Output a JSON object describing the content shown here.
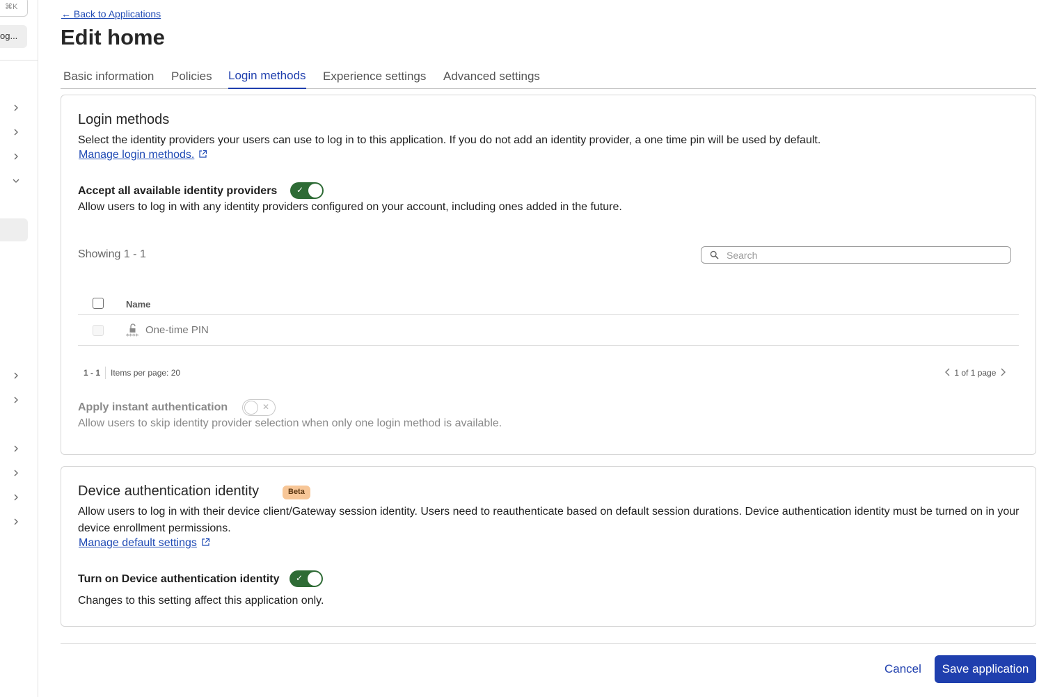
{
  "sidebar": {
    "shortcut_hint": "⌘K",
    "account_label": "og...",
    "icons": [
      "chevron-right-icon",
      "chevron-down-icon"
    ]
  },
  "header": {
    "back_link": "← Back to Applications",
    "title": "Edit home"
  },
  "tabs": [
    {
      "label": "Basic information",
      "active": false
    },
    {
      "label": "Policies",
      "active": false
    },
    {
      "label": "Login methods",
      "active": true
    },
    {
      "label": "Experience settings",
      "active": false
    },
    {
      "label": "Advanced settings",
      "active": false
    }
  ],
  "login_methods": {
    "title": "Login methods",
    "description": "Select the identity providers your users can use to log in to this application. If you do not add an identity provider, a one time pin will be used by default.",
    "manage_link": "Manage login methods.",
    "accept_all": {
      "label": "Accept all available identity providers",
      "enabled": true,
      "description": "Allow users to log in with any identity providers configured on your account, including ones added in the future."
    },
    "showing": "Showing 1 - 1",
    "search_placeholder": "Search",
    "table": {
      "columns": [
        "Name"
      ],
      "rows": [
        {
          "name": "One-time PIN",
          "icon": "lock-pin-icon",
          "checked": false,
          "disabled": true
        }
      ]
    },
    "pagination": {
      "range": "1 - 1",
      "items_per_page": "Items per page: 20",
      "page_info": "1 of 1 page"
    },
    "instant_auth": {
      "label": "Apply instant authentication",
      "enabled": false,
      "description": "Allow users to skip identity provider selection when only one login method is available."
    }
  },
  "device_auth": {
    "title": "Device authentication identity",
    "badge": "Beta",
    "description": "Allow users to log in with their device client/Gateway session identity. Users need to reauthenticate based on default session durations. Device authentication identity must be turned on in your device enrollment permissions.",
    "manage_link": "Manage default settings",
    "toggle": {
      "label": "Turn on Device authentication identity",
      "enabled": true
    },
    "note": "Changes to this setting affect this application only."
  },
  "footer": {
    "cancel_label": "Cancel",
    "save_label": "Save application"
  },
  "colors": {
    "accent": "#1f3fae",
    "toggle_on": "#2e6b35",
    "beta_badge": "#f7c697"
  }
}
